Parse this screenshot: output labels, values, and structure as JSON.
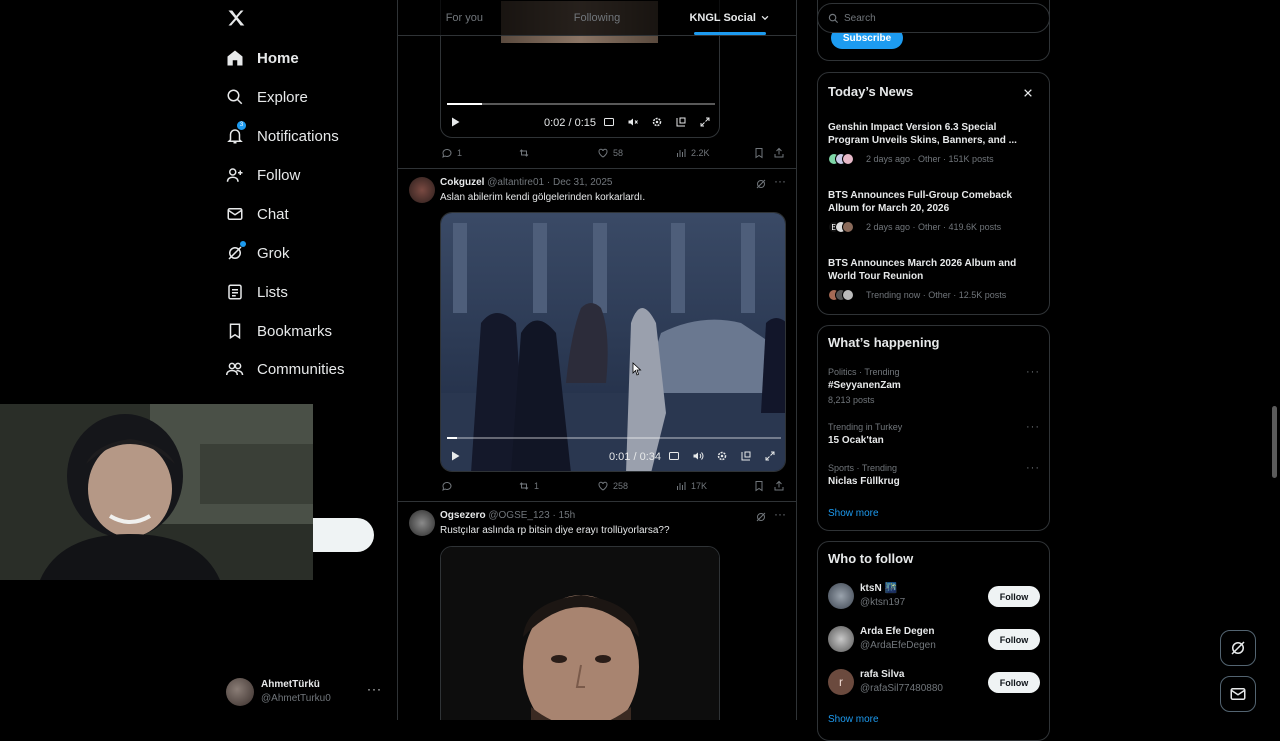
{
  "nav": {
    "items": [
      {
        "label": "Home",
        "icon": "home-icon",
        "active": true
      },
      {
        "label": "Explore",
        "icon": "search-icon"
      },
      {
        "label": "Notifications",
        "icon": "bell-icon",
        "badge": "3"
      },
      {
        "label": "Follow",
        "icon": "person-plus-icon"
      },
      {
        "label": "Chat",
        "icon": "mail-icon"
      },
      {
        "label": "Grok",
        "icon": "grok-icon"
      },
      {
        "label": "Lists",
        "icon": "list-icon"
      },
      {
        "label": "Bookmarks",
        "icon": "bookmark-icon"
      },
      {
        "label": "Communities",
        "icon": "people-icon"
      }
    ],
    "profile": {
      "name": "AhmetTürkü",
      "handle": "@AhmetTurku0"
    }
  },
  "tabs": [
    {
      "label": "For you"
    },
    {
      "label": "Following"
    },
    {
      "label": "KNGL Social",
      "active": true
    }
  ],
  "feed": {
    "video1": {
      "time": "0:02 / 0:15",
      "progress": 0.13
    },
    "tweet1_actions": {
      "replies": "1",
      "reposts": "",
      "likes": "58",
      "views": "2.2K"
    },
    "tweet2": {
      "name": "Cokguzel",
      "handle": "@altantire01",
      "date": "· Dec 31, 2025",
      "text": "Aslan abilerim kendi gölgelerinden korkarlardı.",
      "video_time": "0:01 / 0:34",
      "progress": 0.03,
      "replies": "",
      "reposts": "1",
      "likes": "258",
      "views": "17K"
    },
    "tweet3": {
      "name": "Ogsezero",
      "handle": "@OGSE_123",
      "date": "· 15h",
      "text": "Rustçılar aslında rp bitsin diye erayı trollüyorlarsa??"
    }
  },
  "search": {
    "placeholder": "Search"
  },
  "subscribe": {
    "label": "Subscribe"
  },
  "news": {
    "title": "Today’s News",
    "items": [
      {
        "title": "Genshin Impact Version 6.3 Special Program Unveils Skins, Banners, and ...",
        "meta": "2 days ago · Other · 151K posts"
      },
      {
        "title": "BTS Announces Full-Group Comeback Album for March 20, 2026",
        "meta": "2 days ago · Other · 419.6K posts"
      },
      {
        "title": "BTS Announces March 2026 Album and World Tour Reunion",
        "meta": "Trending now · Other · 12.5K posts"
      }
    ]
  },
  "happening": {
    "title": "What’s happening",
    "items": [
      {
        "category": "Politics · Trending",
        "name": "#SeyyanenZam",
        "posts": "8,213 posts"
      },
      {
        "category": "Trending in Turkey",
        "name": "15 Ocak'tan",
        "posts": ""
      },
      {
        "category": "Sports · Trending",
        "name": "Niclas Füllkrug",
        "posts": ""
      }
    ],
    "show_more": "Show more"
  },
  "who_to_follow": {
    "title": "Who to follow",
    "items": [
      {
        "name": "ktsN 🌃",
        "handle": "@ktsn197",
        "button": "Follow"
      },
      {
        "name": "Arda Efe Degen",
        "handle": "@ArdaEfeDegen",
        "button": "Follow"
      },
      {
        "name": "rafa Silva",
        "handle": "@rafaSil77480880",
        "button": "Follow",
        "initial": "r"
      }
    ],
    "show_more": "Show more"
  },
  "colors": {
    "accent": "#1d9bf0",
    "background": "#000000",
    "border": "#2f3336",
    "muted": "#71767b"
  }
}
